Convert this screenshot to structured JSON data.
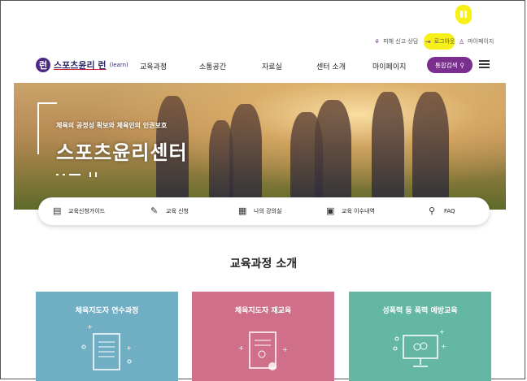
{
  "util": {
    "report": "피해 신고·상담",
    "login": "로그아웃",
    "mypage": "마이페이지"
  },
  "logo": {
    "text": "스포츠윤리 런",
    "sub": "(learn)",
    "mark": "런"
  },
  "nav": [
    "교육과정",
    "소통공간",
    "자료실",
    "센터 소개",
    "마이페이지"
  ],
  "search": {
    "label": "통합검색"
  },
  "hero": {
    "subtitle": "체육의 공정성 확보와 체육인의 인권보호",
    "title": "스포츠윤리센터"
  },
  "quick": [
    "교육신청가이드",
    "교육 신청",
    "나의 강의실",
    "교육 이수내역",
    "FAQ"
  ],
  "section": {
    "title": "교육과정 소개"
  },
  "cards": [
    {
      "title": "체육지도자 연수과정",
      "color": "#6faec3"
    },
    {
      "title": "체육지도자 재교육",
      "color": "#cf6f8a"
    },
    {
      "title": "성폭력 등 폭력 예방교육",
      "color": "#64b8a3"
    }
  ]
}
